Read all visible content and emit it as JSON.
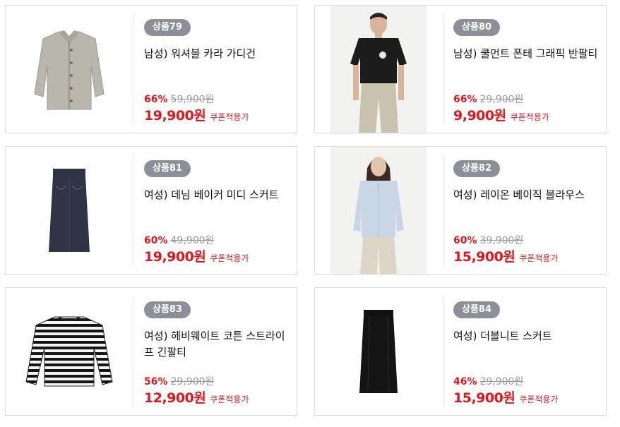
{
  "coupon_label": "쿠폰적용가",
  "products": [
    {
      "badge": "상품79",
      "name": "남성) 워셔블 카라 가디건",
      "rate": "66%",
      "original": "59,900원",
      "price": "19,900원",
      "image": "cardigan-image"
    },
    {
      "badge": "상품80",
      "name": "남성) 쿨먼트 폰테 그래픽 반팔티",
      "rate": "66%",
      "original": "29,900원",
      "price": "9,900원",
      "image": "tshirt-model-image"
    },
    {
      "badge": "상품81",
      "name": "여성) 데님 베이커 미디 스커트",
      "rate": "60%",
      "original": "49,900원",
      "price": "19,900원",
      "image": "denim-skirt-image"
    },
    {
      "badge": "상품82",
      "name": "여성) 레이온 베이직 블라우스",
      "rate": "60%",
      "original": "39,900원",
      "price": "15,900원",
      "image": "blouse-model-image"
    },
    {
      "badge": "상품83",
      "name": "여성) 헤비웨이트 코튼 스트라이프 긴팔티",
      "rate": "56%",
      "original": "29,900원",
      "price": "12,900원",
      "image": "striped-longsleeve-image"
    },
    {
      "badge": "상품84",
      "name": "여성) 더블니트 스커트",
      "rate": "46%",
      "original": "29,900원",
      "price": "15,900원",
      "image": "black-skirt-image"
    }
  ],
  "colors": {
    "accent": "#e0181e",
    "badge": "#8c8f99",
    "border": "#dcdcdc"
  }
}
